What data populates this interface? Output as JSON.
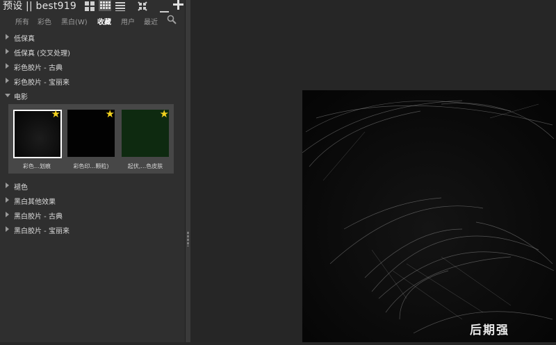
{
  "header": {
    "title": "预设 || best919",
    "grid_large_icon": "grid-large-icon",
    "grid_small_icon": "grid-small-icon",
    "list_icon": "list-icon",
    "collapse_icon": "collapse-icon",
    "remove_icon": "minus-icon",
    "add_icon": "plus-icon"
  },
  "tabs": [
    {
      "label": "所有"
    },
    {
      "label": "彩色"
    },
    {
      "label": "黑白(W)"
    },
    {
      "label": "收藏",
      "active": true
    },
    {
      "label": "用户"
    },
    {
      "label": "最近"
    }
  ],
  "groups_before": [
    {
      "label": "低保真"
    },
    {
      "label": "低保真 (交叉处理)"
    },
    {
      "label": "彩色胶片 - 古典"
    },
    {
      "label": "彩色胶片 - 宝丽来"
    },
    {
      "label": "电影",
      "expanded": true
    }
  ],
  "thumbnails": [
    {
      "caption": "彩色…划痕",
      "selected": true,
      "favorite": true,
      "color": "#0d0d0d"
    },
    {
      "caption": "彩色印…颗粒)",
      "selected": false,
      "favorite": true,
      "color": "#020202"
    },
    {
      "caption": "起伏,…色皮肤",
      "selected": false,
      "favorite": true,
      "color": "#0e2a10"
    }
  ],
  "groups_after": [
    {
      "label": "褪色"
    },
    {
      "label": "黑白其他效果"
    },
    {
      "label": "黑白胶片 - 古典"
    },
    {
      "label": "黑白胶片 - 宝丽来"
    }
  ],
  "watermark": "后期强",
  "colors": {
    "panel_bg": "#2f2f2f",
    "canvas_bg": "#262626",
    "thumb_strip_bg": "#474747",
    "star": "#f3d21e",
    "preview_bg": "#0b0b0b"
  }
}
